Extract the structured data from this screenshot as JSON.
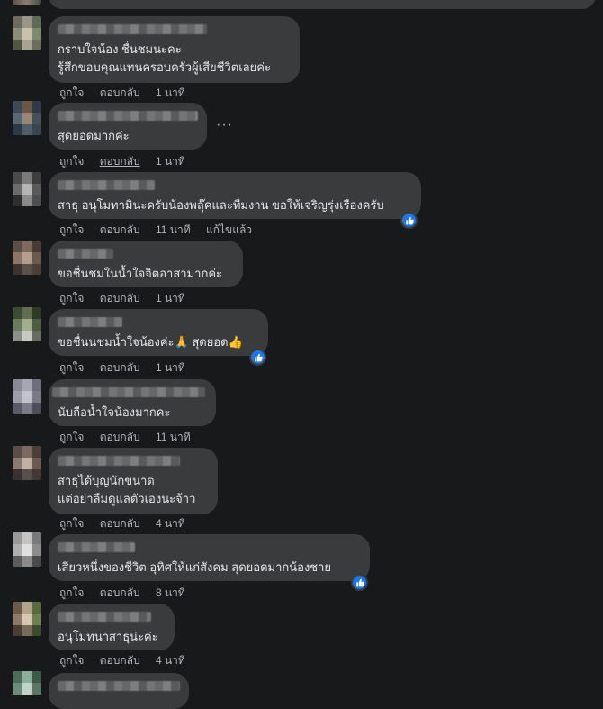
{
  "comments": [
    {
      "lines": [
        "กราบใจน้อง ชื่นชมนะคะ",
        "รู้สึกขอบคุณแทนครอบครัวผู้เสียชีวิตเลยค่ะ"
      ],
      "like": "ถูกใจ",
      "reply": "ตอบกลับ",
      "time": "1 นาที"
    },
    {
      "lines": [
        "สุดยอดมากค่ะ"
      ],
      "like": "ถูกใจ",
      "reply": "ตอบกลับ",
      "time": "1 นาที",
      "more": "···"
    },
    {
      "lines": [
        "สาธุ อนุโมทามินะครับน้องพลุ๊คและทีมงาน ขอให้เจริญรุ่งเรืองครับ"
      ],
      "like": "ถูกใจ",
      "reply": "ตอบกลับ",
      "time": "11 นาที",
      "edited": "แก้ไขแล้ว",
      "reaction": "like"
    },
    {
      "lines": [
        "ขอชื่นชมในน้ำใจจิตอาสามากค่ะ"
      ],
      "like": "ถูกใจ",
      "reply": "ตอบกลับ",
      "time": "1 นาที"
    },
    {
      "lines": [
        "ขอชื่นนชมน้ำใจน้องค่ะ🙏 สุดยอด👍"
      ],
      "like": "ถูกใจ",
      "reply": "ตอบกลับ",
      "time": "1 นาที",
      "reaction": "like"
    },
    {
      "lines": [
        "นับถือน้ำใจน้องมากคะ"
      ],
      "like": "ถูกใจ",
      "reply": "ตอบกลับ",
      "time": "11 นาที"
    },
    {
      "lines": [
        "สาธุได้บุญนักขนาด",
        "แต่อย่าลืมดูแลตัวเองนะจ้าว"
      ],
      "like": "ถูกใจ",
      "reply": "ตอบกลับ",
      "time": "4 นาที"
    },
    {
      "lines": [
        "เสียวหนึ่งของชีวิต อุทิศให้แก่สังคม สุดยอดมากน้องชาย"
      ],
      "like": "ถูกใจ",
      "reply": "ตอบกลับ",
      "time": "8 นาที",
      "reaction": "like"
    },
    {
      "lines": [
        "อนุโมทนาสาธุน่ะค่ะ"
      ],
      "like": "ถูกใจ",
      "reply": "ตอบกลับ",
      "time": "4 นาที"
    }
  ],
  "colors": {
    "background": "#18191a",
    "bubble": "#3a3b3c",
    "text": "#e4e6eb",
    "muted": "#b0b3b8",
    "like_blue": "#1877f2"
  },
  "icons": {
    "reaction": "thumbs-up-icon",
    "more": "more-options-icon"
  }
}
